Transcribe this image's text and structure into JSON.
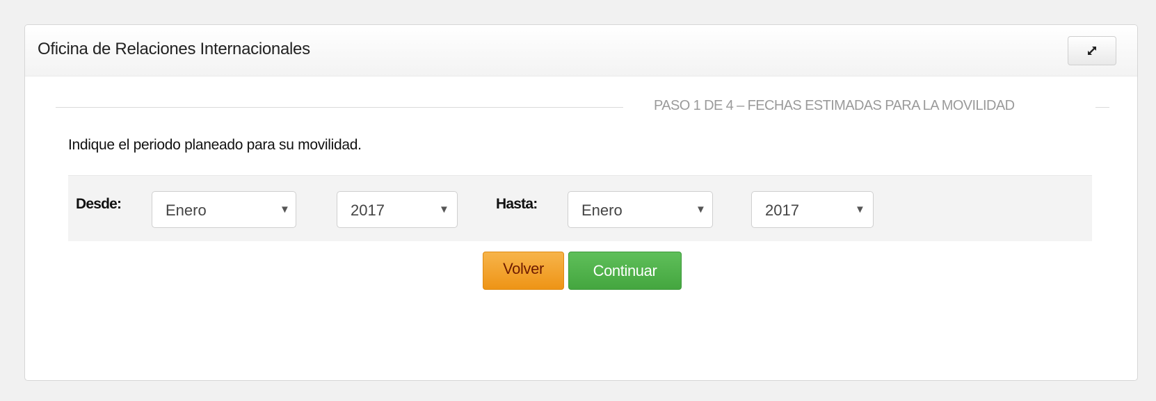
{
  "panel": {
    "title": "Oficina de Relaciones Internacionales",
    "expand_icon": "expand-icon"
  },
  "step": {
    "title": "PASO 1 DE 4 – FECHAS ESTIMADAS PARA LA MOVILIDAD"
  },
  "intro_text": "Indique el periodo planeado para su movilidad.",
  "form": {
    "desde_label": "Desde:",
    "desde_month": "Enero",
    "desde_year": "2017",
    "hasta_label": "Hasta:",
    "hasta_month": "Enero",
    "hasta_year": "2017",
    "dropdown_icon": "chevron-down-icon"
  },
  "buttons": {
    "volver": "Volver",
    "continuar": "Continuar"
  },
  "colors": {
    "volver": "#f0a030",
    "continuar": "#4cae4c"
  }
}
